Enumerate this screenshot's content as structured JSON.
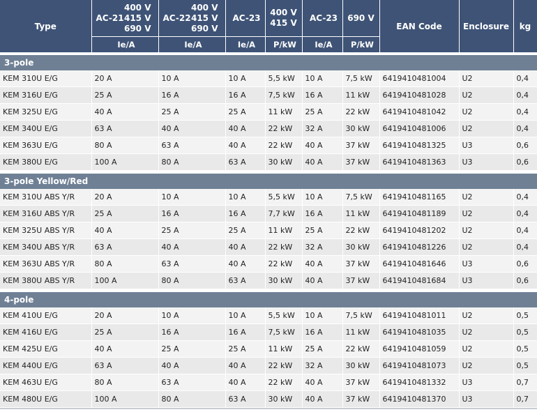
{
  "header": {
    "type": "Type",
    "ac21": "AC-21",
    "ac22": "AC-22",
    "ac23": "AC-23",
    "volts_multi": [
      "400 V",
      "415 V",
      "690 V"
    ],
    "volts_pair": [
      "400 V",
      "415 V"
    ],
    "v690": "690 V",
    "ean": "EAN Code",
    "enclosure": "Enclosure",
    "kg": "kg",
    "units": [
      "Ie/A",
      "Ie/A",
      "Ie/A",
      "P/kW",
      "Ie/A",
      "P/kW"
    ]
  },
  "groups": [
    {
      "title": "3-pole",
      "rows": [
        [
          "KEM 310U E/G",
          "20 A",
          "10 A",
          "10 A",
          "5,5 kW",
          "10 A",
          "7,5 kW",
          "6419410481004",
          "U2",
          "0,4"
        ],
        [
          "KEM 316U E/G",
          "25 A",
          "16 A",
          "16 A",
          "7,5 kW",
          "16 A",
          "11 kW",
          "6419410481028",
          "U2",
          "0,4"
        ],
        [
          "KEM 325U E/G",
          "40 A",
          "25 A",
          "25 A",
          "11 kW",
          "25 A",
          "22 kW",
          "6419410481042",
          "U2",
          "0,4"
        ],
        [
          "KEM 340U E/G",
          "63 A",
          "40 A",
          "40 A",
          "22 kW",
          "32 A",
          "30 kW",
          "6419410481006",
          "U2",
          "0,4"
        ],
        [
          "KEM 363U E/G",
          "80 A",
          "63 A",
          "40 A",
          "22 kW",
          "40 A",
          "37 kW",
          "6419410481325",
          "U3",
          "0,6"
        ],
        [
          "KEM 380U E/G",
          "100 A",
          "80 A",
          "63 A",
          "30 kW",
          "40 A",
          "37 kW",
          "6419410481363",
          "U3",
          "0,6"
        ]
      ]
    },
    {
      "title": "3-pole Yellow/Red",
      "rows": [
        [
          "KEM 310U ABS Y/R",
          "20 A",
          "10 A",
          "10 A",
          "5,5 kW",
          "10 A",
          "7,5 kW",
          "6419410481165",
          "U2",
          "0,4"
        ],
        [
          "KEM 316U ABS Y/R",
          "25 A",
          "16 A",
          "16 A",
          "7,7 kW",
          "16 A",
          "11 kW",
          "6419410481189",
          "U2",
          "0,4"
        ],
        [
          "KEM 325U ABS Y/R",
          "40 A",
          "25 A",
          "25 A",
          "11 kW",
          "25 A",
          "22 kW",
          "6419410481202",
          "U2",
          "0,4"
        ],
        [
          "KEM 340U ABS Y/R",
          "63 A",
          "40 A",
          "40 A",
          "22 kW",
          "32 A",
          "30 kW",
          "6419410481226",
          "U2",
          "0,4"
        ],
        [
          "KEM 363U ABS Y/R",
          "80 A",
          "63 A",
          "40 A",
          "22 kW",
          "40 A",
          "37 kW",
          "6419410481646",
          "U3",
          "0,6"
        ],
        [
          "KEM 380U ABS Y/R",
          "100 A",
          "80 A",
          "63 A",
          "30 kW",
          "40 A",
          "37 kW",
          "6419410481684",
          "U3",
          "0,6"
        ]
      ]
    },
    {
      "title": "4-pole",
      "rows": [
        [
          "KEM 410U E/G",
          "20 A",
          "10 A",
          "10 A",
          "5,5 kW",
          "10 A",
          "7,5 kW",
          "6419410481011",
          "U2",
          "0,5"
        ],
        [
          "KEM 416U E/G",
          "25 A",
          "16 A",
          "16 A",
          "7,5 kW",
          "16 A",
          "11 kW",
          "6419410481035",
          "U2",
          "0,5"
        ],
        [
          "KEM 425U E/G",
          "40 A",
          "25 A",
          "25 A",
          "11 kW",
          "25 A",
          "22 kW",
          "6419410481059",
          "U2",
          "0,5"
        ],
        [
          "KEM 440U E/G",
          "63 A",
          "40 A",
          "40 A",
          "22 kW",
          "32 A",
          "30 kW",
          "6419410481073",
          "U2",
          "0,5"
        ],
        [
          "KEM 463U E/G",
          "80 A",
          "63 A",
          "40 A",
          "22 kW",
          "40 A",
          "37 kW",
          "6419410481332",
          "U3",
          "0,7"
        ],
        [
          "KEM 480U E/G",
          "100 A",
          "80 A",
          "63 A",
          "30 kW",
          "40 A",
          "37 kW",
          "6419410481370",
          "U3",
          "0,7"
        ]
      ]
    }
  ]
}
